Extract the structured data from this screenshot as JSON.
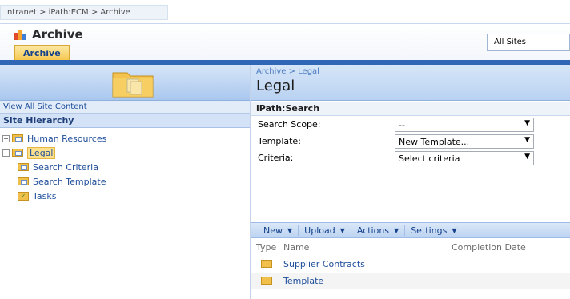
{
  "breadcrumb": "Intranet > iPath:ECM > Archive",
  "site": {
    "title": "Archive"
  },
  "scope": {
    "value": "All Sites"
  },
  "tabs": [
    {
      "label": "Archive"
    }
  ],
  "left": {
    "view_all": "View All Site Content",
    "hierarchy_title": "Site Hierarchy",
    "items": [
      {
        "label": "Human Resources",
        "expand": "+"
      },
      {
        "label": "Legal",
        "expand": "+"
      },
      {
        "label": "Search Criteria"
      },
      {
        "label": "Search Template"
      },
      {
        "label": "Tasks"
      }
    ]
  },
  "main": {
    "sub_crumb": "Archive > Legal",
    "page_title": "Legal",
    "webpart_title": "iPath:Search",
    "form": [
      {
        "label": "Search Scope:",
        "value": "--"
      },
      {
        "label": "Template:",
        "value": "New Template..."
      },
      {
        "label": "Criteria:",
        "value": "Select criteria"
      }
    ],
    "toolbar": {
      "new": "New",
      "upload": "Upload",
      "actions": "Actions",
      "settings": "Settings"
    },
    "columns": {
      "type": "Type",
      "name": "Name",
      "date": "Completion Date"
    },
    "rows": [
      {
        "name": "Supplier Contracts"
      },
      {
        "name": "Template"
      }
    ]
  },
  "colors": {
    "accent": "#3066b6",
    "tab": "#f5c64c",
    "link": "#1f4e9b"
  }
}
